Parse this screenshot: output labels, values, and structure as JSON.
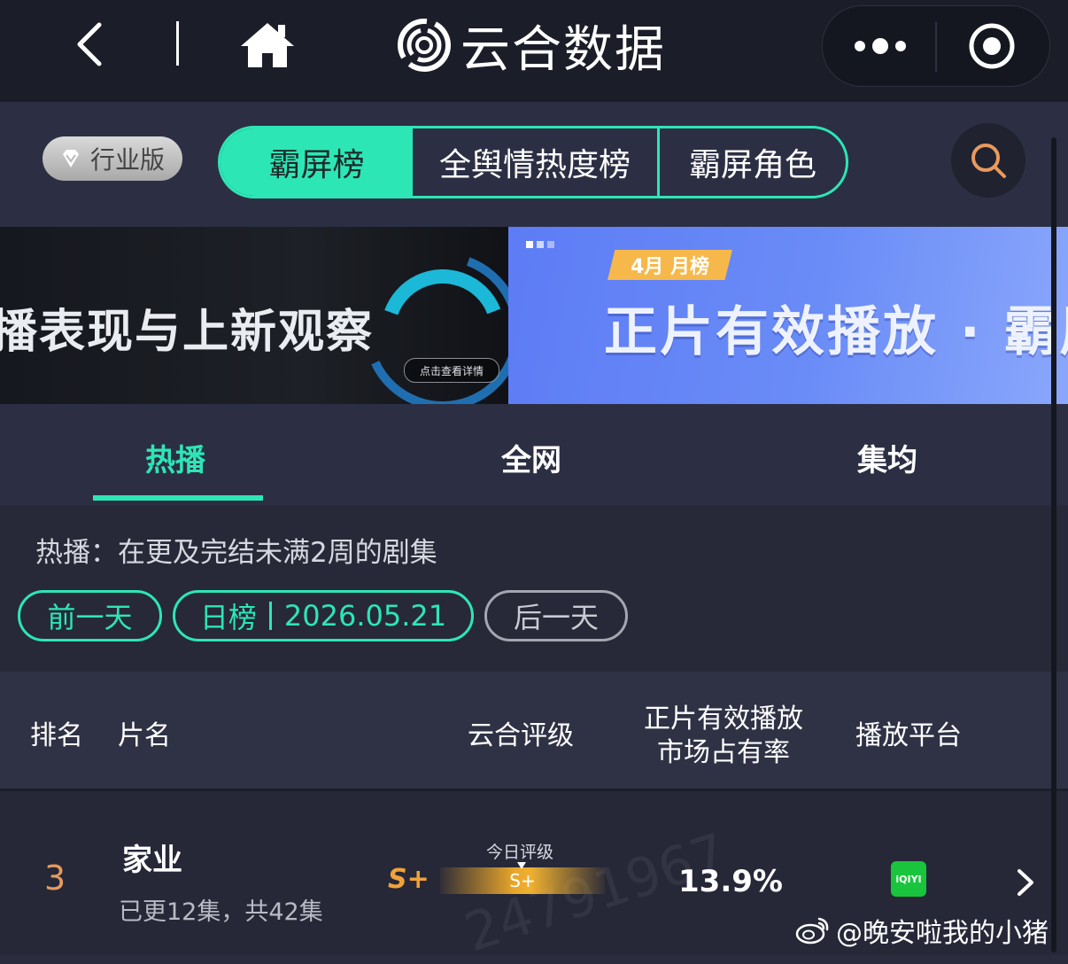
{
  "nav": {
    "title": "云合数据"
  },
  "tabs": {
    "edition": "行业版",
    "items": [
      "霸屏榜",
      "全舆情热度榜",
      "霸屏角色"
    ]
  },
  "banners": {
    "left_text": "播表现与上新观察",
    "left_button": "点击查看详情",
    "right_tag": "4月 月榜",
    "right_text": "正片有效播放 · 霸屏"
  },
  "subtabs": [
    "热播",
    "全网",
    "集均"
  ],
  "filters": {
    "note": "热播：在更及完结未满2周的剧集",
    "prev": "前一天",
    "date_label": "日榜",
    "date": "2026.05.21",
    "next": "后一天"
  },
  "table": {
    "headers": {
      "rank": "排名",
      "title": "片名",
      "rating": "云合评级",
      "share_line1": "正片有效播放",
      "share_line2": "市场占有率",
      "platform": "播放平台"
    },
    "rows": [
      {
        "rank": "3",
        "title": "家业",
        "episodes": "已更12集，共42集",
        "grade": "S+",
        "today_label": "今日评级",
        "today_grade": "S+",
        "share": "13.9%",
        "platform": "iQIYI"
      }
    ]
  },
  "watermark": {
    "handle": "@晚安啦我的小猪",
    "number": "24791967"
  },
  "colors": {
    "accent": "#2de6b6",
    "grade": "#f0a23a",
    "rank": "#e89a5e"
  }
}
